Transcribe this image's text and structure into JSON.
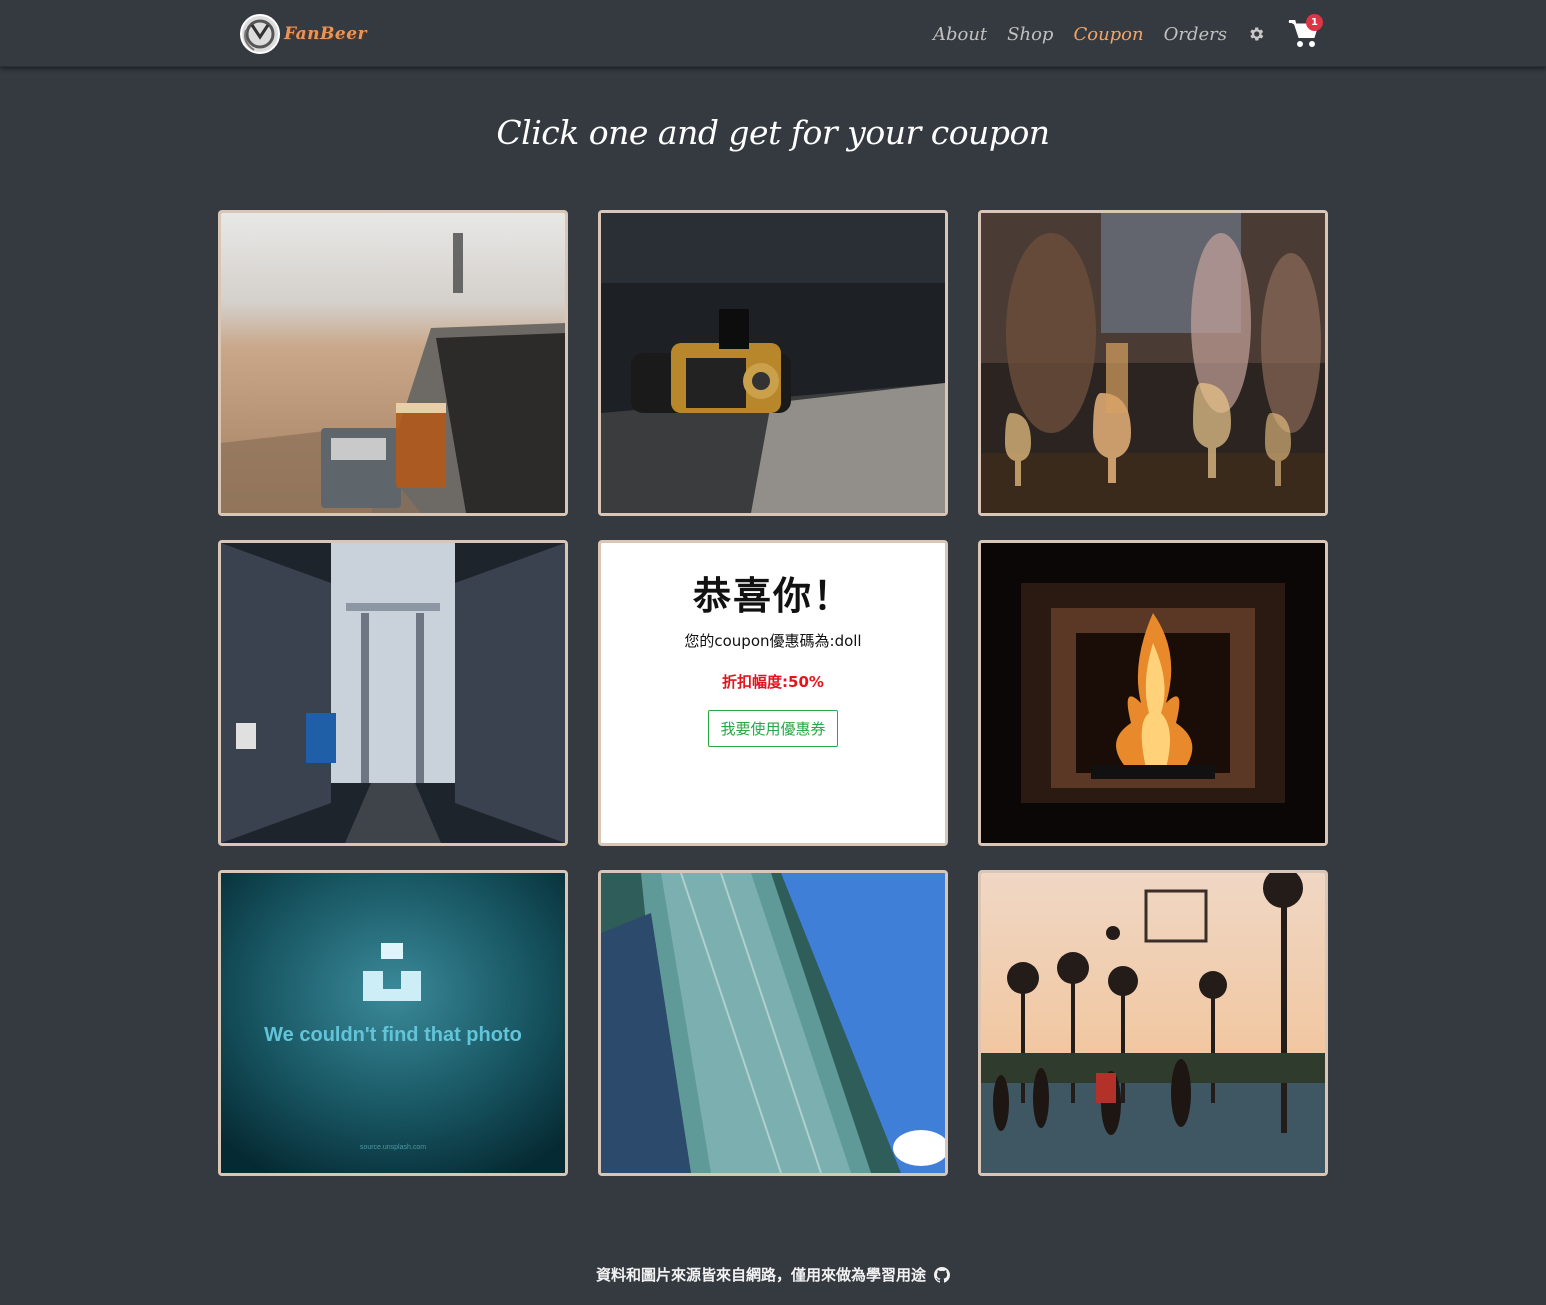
{
  "navbar": {
    "brand": "FanBeer",
    "links": [
      {
        "label": "About",
        "active": false
      },
      {
        "label": "Shop",
        "active": false
      },
      {
        "label": "Coupon",
        "active": true
      },
      {
        "label": "Orders",
        "active": false
      }
    ],
    "settings_icon": "gear-icon",
    "cart_icon": "shopping-cart-icon",
    "cart_count": "1"
  },
  "heading": "Click one and get for your coupon",
  "cards": [
    {
      "image": "beach-beer-peanuts-photo"
    },
    {
      "image": "vape-device-photo"
    },
    {
      "image": "party-drinks-photo"
    },
    {
      "image": "brewery-tanks-photo"
    },
    {
      "image": "coupon-revealed"
    },
    {
      "image": "fireplace-photo"
    },
    {
      "image": "photo-not-found"
    },
    {
      "image": "taipei-101-photo"
    },
    {
      "image": "basketball-court-photo"
    }
  ],
  "coupon": {
    "title": "恭喜你！",
    "code_text": "您的coupon優惠碼為:doll",
    "discount_text": "折扣幅度:50%",
    "button_label": "我要使用優惠券"
  },
  "missing_photo": {
    "message": "We couldn't find that photo",
    "source": "source.unsplash.com"
  },
  "footer": {
    "text": "資料和圖片來源皆來自網路，僅用來做為學習用途",
    "icon": "github-icon"
  },
  "colors": {
    "background": "#343a40",
    "accent": "#f0a46a",
    "card_border": "#d9c6b6",
    "badge": "#dc3545",
    "discount": "#e3141d",
    "button": "#28a745"
  }
}
